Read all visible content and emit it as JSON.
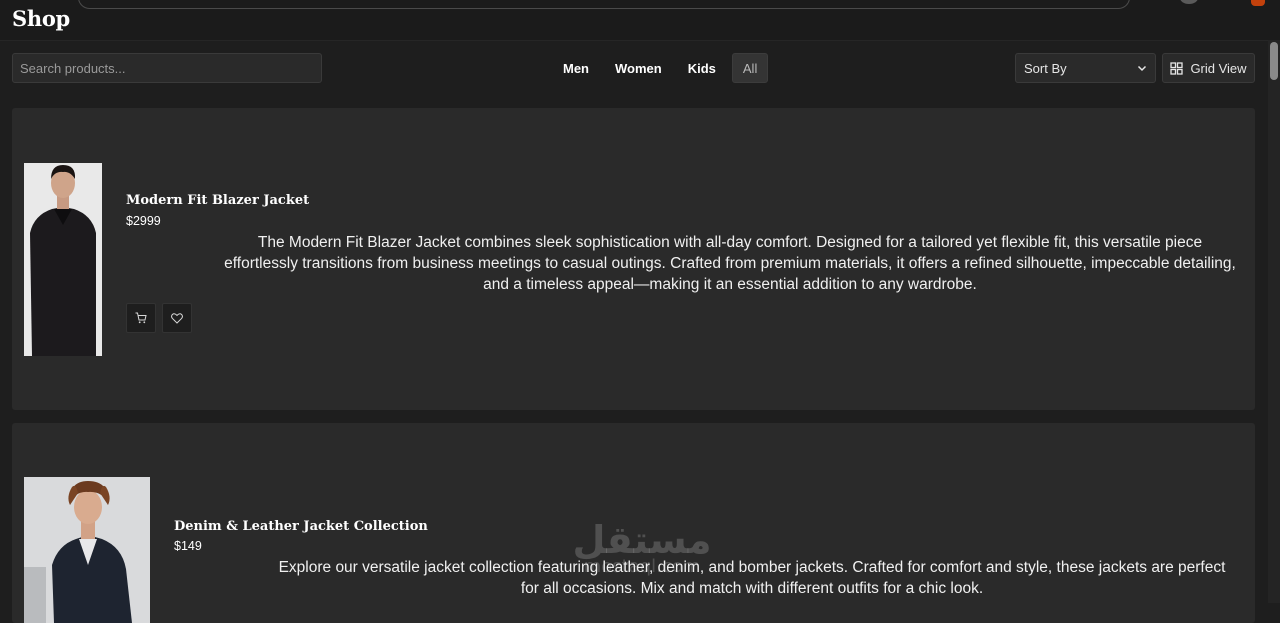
{
  "header": {
    "title": "Shop"
  },
  "search": {
    "placeholder": "Search products..."
  },
  "filters": [
    "Men",
    "Women",
    "Kids",
    "All"
  ],
  "active_filter": "All",
  "sort": {
    "label": "Sort By"
  },
  "view_toggle": {
    "label": "Grid View"
  },
  "products": [
    {
      "name": "Modern Fit Blazer Jacket",
      "price": "$2999",
      "description": "The Modern Fit Blazer Jacket combines sleek sophistication with all-day comfort. Designed for a tailored yet flexible fit, this versatile piece effortlessly transitions from business meetings to casual outings. Crafted from premium materials, it offers a refined silhouette, impeccable detailing, and a timeless appeal—making it an essential addition to any wardrobe."
    },
    {
      "name": "Denim & Leather Jacket Collection",
      "price": "$149",
      "description": "Explore our versatile jacket collection featuring leather, denim, and bomber jackets. Crafted for comfort and style, these jackets are perfect for all occasions. Mix and match with different outfits for a chic look."
    }
  ],
  "icons": {
    "cart": "cart-icon",
    "wishlist": "heart-icon",
    "grid": "grid-icon",
    "dropdown": "chevron-down-icon"
  },
  "watermark": {
    "arabic": "مستقل",
    "latin": "mostaql.com"
  },
  "colors": {
    "background": "#1e1e1e",
    "card": "#2a2a2a",
    "text": "#ffffff"
  }
}
